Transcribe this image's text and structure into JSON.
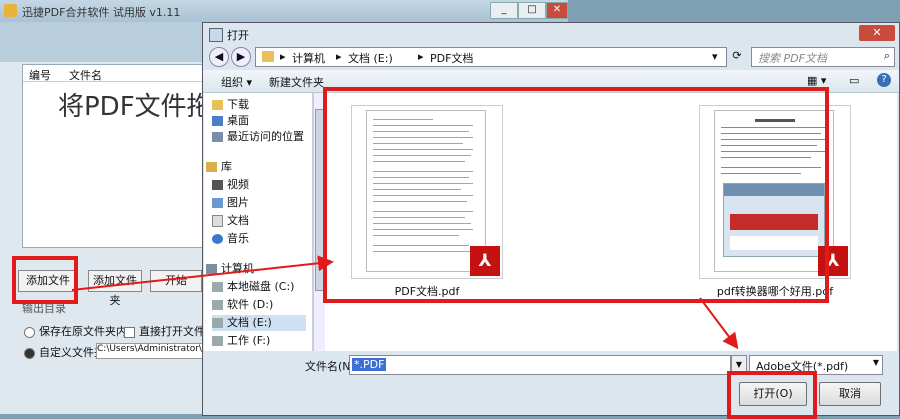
{
  "background_window": {
    "title": "迅捷PDF合并软件 试用版 v1.11",
    "list_headers": {
      "no": "编号",
      "name": "文件名"
    },
    "drop_hint": "将PDF文件拖",
    "buttons": {
      "add_file": "添加文件",
      "add_folder": "添加文件夹",
      "start": "开始"
    },
    "output_dir_label": "输出目录",
    "option_same_folder": "保存在原文件夹内",
    "option_open_file": "直接打开文件",
    "option_custom_folder": "自定义文件夹",
    "custom_path": "C:\\Users\\Administrator\\De"
  },
  "dialog": {
    "title": "打开",
    "breadcrumb": [
      "计算机",
      "文档 (E:)",
      "PDF文档"
    ],
    "search_placeholder": "搜索 PDF文档",
    "toolbar": {
      "organize": "组织 ▾",
      "new_folder": "新建文件夹"
    },
    "nav": [
      {
        "label": "下载",
        "icon": "folder-icon"
      },
      {
        "label": "桌面",
        "icon": "desktop-icon"
      },
      {
        "label": "最近访问的位置",
        "icon": "recent-icon"
      },
      {
        "label": "库",
        "icon": "library-icon"
      },
      {
        "label": "视频",
        "icon": "video-icon"
      },
      {
        "label": "图片",
        "icon": "picture-icon"
      },
      {
        "label": "文档",
        "icon": "document-icon"
      },
      {
        "label": "音乐",
        "icon": "music-icon"
      },
      {
        "label": "计算机",
        "icon": "computer-icon"
      },
      {
        "label": "本地磁盘 (C:)",
        "icon": "drive-icon"
      },
      {
        "label": "软件 (D:)",
        "icon": "drive-icon"
      },
      {
        "label": "文档 (E:)",
        "icon": "drive-icon"
      },
      {
        "label": "工作 (F:)",
        "icon": "drive-icon"
      }
    ],
    "files": [
      {
        "name": "PDF文档.pdf"
      },
      {
        "name": "pdf转换器哪个好用.pdf"
      }
    ],
    "filename_label": "文件名(N):",
    "filename_value": "*.PDF",
    "file_type": "Adobe文件(*.pdf)",
    "open_button": "打开(O)",
    "cancel_button": "取消"
  },
  "colors": {
    "highlight": "#e01b1b",
    "pdf_badge": "#c41212",
    "selection": "#3b6fd6"
  }
}
